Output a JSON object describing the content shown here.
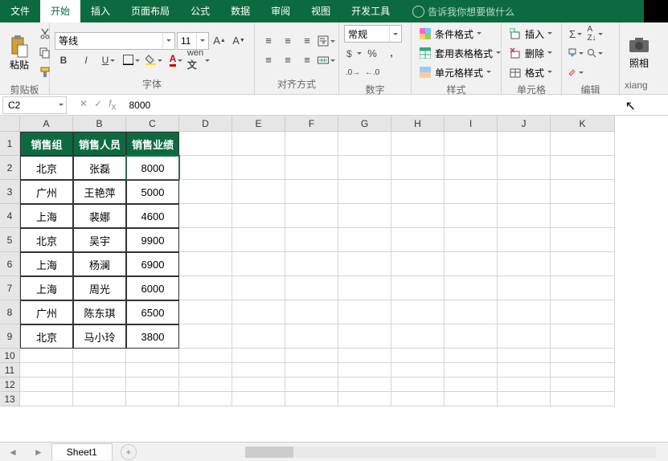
{
  "tabs": {
    "file": "文件",
    "home": "开始",
    "insert": "插入",
    "layout": "页面布局",
    "formula": "公式",
    "data": "数据",
    "review": "审阅",
    "view": "视图",
    "dev": "开发工具",
    "tell": "告诉我你想要做什么"
  },
  "ribbon": {
    "clipboard": {
      "paste": "粘贴",
      "label": "剪贴板"
    },
    "font": {
      "name": "等线",
      "size": "11",
      "label": "字体"
    },
    "align": {
      "label": "对齐方式"
    },
    "number": {
      "general": "常规",
      "label": "数字"
    },
    "styles": {
      "cond": "条件格式",
      "table": "套用表格格式",
      "cell": "单元格样式",
      "label": "样式"
    },
    "cells": {
      "insert": "插入",
      "delete": "删除",
      "format": "格式",
      "label": "单元格"
    },
    "editing": {
      "label": "编辑"
    },
    "camera": {
      "label": "照相",
      "side": "xiang"
    }
  },
  "formula_bar": {
    "ref": "C2",
    "value": "8000"
  },
  "columns": [
    "A",
    "B",
    "C",
    "D",
    "E",
    "F",
    "G",
    "H",
    "I",
    "J",
    "K"
  ],
  "table": {
    "headers": [
      "销售组",
      "销售人员",
      "销售业绩"
    ],
    "rows": [
      [
        "北京",
        "张磊",
        "8000"
      ],
      [
        "广州",
        "王艳萍",
        "5000"
      ],
      [
        "上海",
        "裴娜",
        "4600"
      ],
      [
        "北京",
        "吴宇",
        "9900"
      ],
      [
        "上海",
        "杨澜",
        "6900"
      ],
      [
        "上海",
        "周光",
        "6000"
      ],
      [
        "广州",
        "陈东琪",
        "6500"
      ],
      [
        "北京",
        "马小玲",
        "3800"
      ]
    ]
  },
  "sheet_tab": "Sheet1",
  "chart_data": {
    "type": "table",
    "title": "销售业绩",
    "columns": [
      "销售组",
      "销售人员",
      "销售业绩"
    ],
    "rows": [
      [
        "北京",
        "张磊",
        8000
      ],
      [
        "广州",
        "王艳萍",
        5000
      ],
      [
        "上海",
        "裴娜",
        4600
      ],
      [
        "北京",
        "吴宇",
        9900
      ],
      [
        "上海",
        "杨澜",
        6900
      ],
      [
        "上海",
        "周光",
        6000
      ],
      [
        "广州",
        "陈东琪",
        6500
      ],
      [
        "北京",
        "马小玲",
        3800
      ]
    ]
  }
}
